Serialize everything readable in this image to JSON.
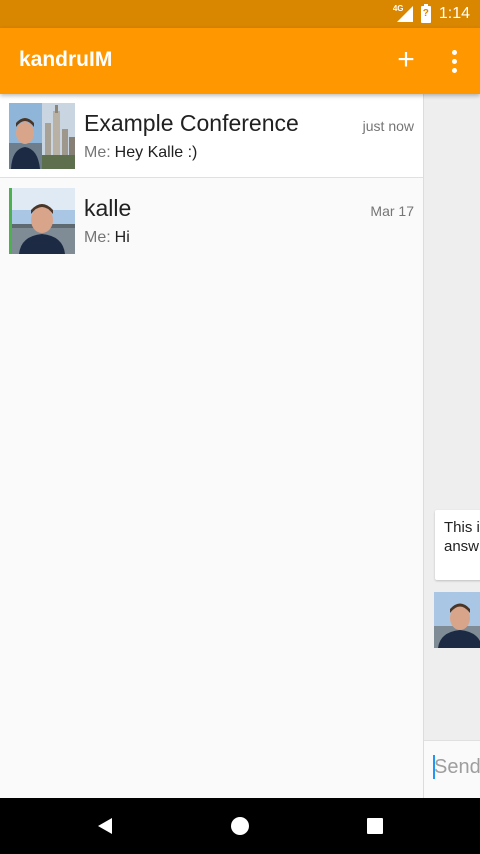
{
  "status_bar": {
    "network": "4G",
    "battery": "?",
    "time": "1:14"
  },
  "app_bar": {
    "title": "kandruIM",
    "add_label": "+",
    "overflow_icon": "more-vert-icon"
  },
  "conversations": [
    {
      "name": "Example Conference",
      "time": "just now",
      "sender": "Me:",
      "preview": "Hey Kalle :)",
      "avatar": "group-avatar"
    },
    {
      "name": "kalle",
      "time": "Mar 17",
      "sender": "Me:",
      "preview": "Hi",
      "avatar": "user-avatar"
    }
  ],
  "chat_pane": {
    "message": "This i\nansw",
    "compose_placeholder": "Send"
  },
  "nav_bar": {
    "back_icon": "back-icon",
    "home_icon": "home-icon",
    "recents_icon": "recents-icon"
  },
  "colors": {
    "status_bar": "#d98600",
    "app_bar": "#ff9800",
    "accent_online": "#4caf50"
  }
}
